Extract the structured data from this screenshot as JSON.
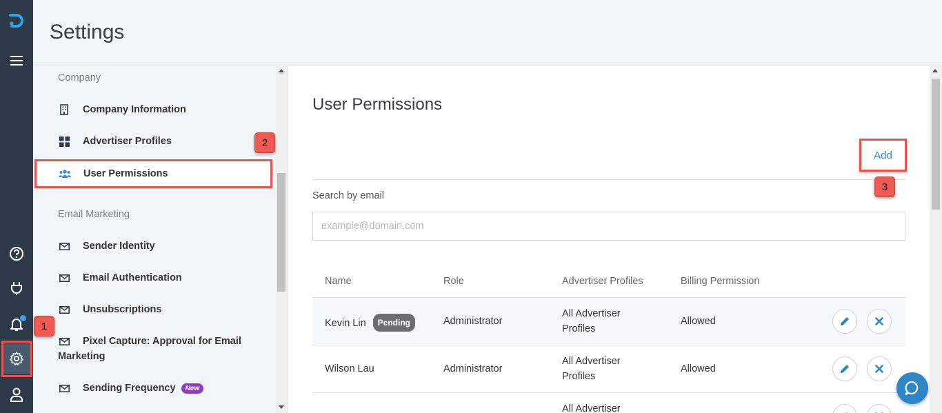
{
  "header": {
    "title": "Settings"
  },
  "rail": {
    "logo_icon": "brand-logo-icon",
    "items": [
      {
        "name": "menu-icon"
      },
      {
        "name": "help-icon"
      },
      {
        "name": "plug-icon"
      },
      {
        "name": "bell-icon"
      },
      {
        "name": "gear-icon"
      },
      {
        "name": "user-icon"
      }
    ]
  },
  "nav": {
    "sections": [
      {
        "label": "Company",
        "items": [
          {
            "label": "Company Information",
            "icon": "building-icon"
          },
          {
            "label": "Advertiser Profiles",
            "icon": "grid-icon"
          },
          {
            "label": "User Permissions",
            "icon": "users-icon",
            "active": true
          }
        ]
      },
      {
        "label": "Email Marketing",
        "items": [
          {
            "label": "Sender Identity",
            "icon": "envelope-icon"
          },
          {
            "label": "Email Authentication",
            "icon": "envelope-icon"
          },
          {
            "label": "Unsubscriptions",
            "icon": "envelope-icon"
          },
          {
            "label": "Pixel Capture: Approval for Email Marketing",
            "icon": "envelope-icon"
          },
          {
            "label": "Sending Frequency",
            "icon": "envelope-icon",
            "badge": "New"
          }
        ]
      }
    ]
  },
  "main": {
    "title": "User Permissions",
    "add_label": "Add",
    "search": {
      "label": "Search by email",
      "placeholder": "example@domain.com",
      "value": ""
    },
    "table": {
      "columns": [
        "Name",
        "Role",
        "Advertiser Profiles",
        "Billing Permission"
      ],
      "rows": [
        {
          "name": "Kevin Lin",
          "status": "Pending",
          "role": "Administrator",
          "profiles_l1": "All Advertiser",
          "profiles_l2": "Profiles",
          "billing": "Allowed"
        },
        {
          "name": "Wilson Lau",
          "status": "",
          "role": "Administrator",
          "profiles_l1": "All Advertiser",
          "profiles_l2": "Profiles",
          "billing": "Allowed"
        },
        {
          "name": "",
          "status": "",
          "role": "",
          "profiles_l1": "All Advertiser",
          "profiles_l2": "",
          "billing": ""
        }
      ]
    }
  },
  "callouts": [
    "1",
    "2",
    "3"
  ],
  "colors": {
    "rail": "#2d3a4a",
    "accent": "#2e86c9",
    "highlight": "#e8554e",
    "new_badge": "#8e3db5",
    "pending_badge": "#6b6f73"
  }
}
